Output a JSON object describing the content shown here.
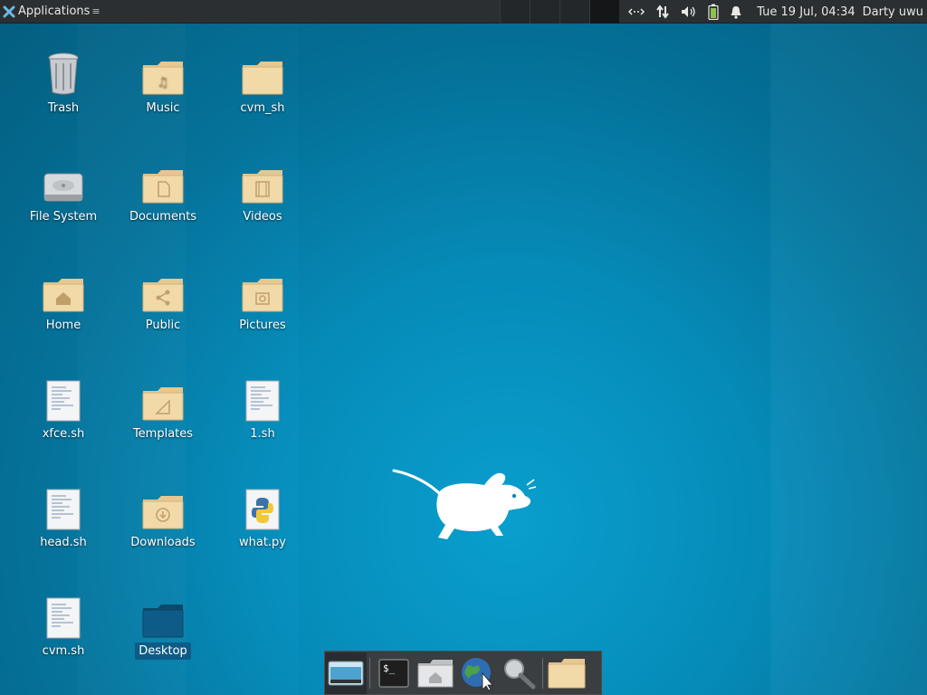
{
  "panel": {
    "applications_label": "Applications",
    "clock": "Tue 19 Jul, 04:34",
    "user": "Darty uwu",
    "tray_icons": [
      "network-transfer-icon",
      "network-icon",
      "volume-icon",
      "battery-icon",
      "notification-bell-icon"
    ]
  },
  "desktop": {
    "icons": [
      {
        "label": "Trash",
        "type": "trash"
      },
      {
        "label": "Music",
        "type": "folder-music"
      },
      {
        "label": "cvm_sh",
        "type": "folder"
      },
      {
        "label": "File System",
        "type": "drive"
      },
      {
        "label": "Documents",
        "type": "folder-documents"
      },
      {
        "label": "Videos",
        "type": "folder-videos"
      },
      {
        "label": "Home",
        "type": "folder-home"
      },
      {
        "label": "Public",
        "type": "folder-public"
      },
      {
        "label": "Pictures",
        "type": "folder-pictures"
      },
      {
        "label": "xfce.sh",
        "type": "text-file"
      },
      {
        "label": "Templates",
        "type": "folder-templates"
      },
      {
        "label": "1.sh",
        "type": "text-file"
      },
      {
        "label": "head.sh",
        "type": "text-file"
      },
      {
        "label": "Downloads",
        "type": "folder-downloads"
      },
      {
        "label": "what.py",
        "type": "python-file"
      },
      {
        "label": "cvm.sh",
        "type": "text-file"
      },
      {
        "label": "Desktop",
        "type": "folder-desktop",
        "selected": true
      }
    ]
  },
  "dock": {
    "items": [
      "show-desktop-icon",
      "terminal-icon",
      "home-folder-icon",
      "web-browser-icon",
      "search-icon",
      "file-manager-icon"
    ]
  },
  "colors": {
    "panel_bg": "#2b2f31",
    "desktop_bg": "#078dbb",
    "folder": "#f2d9a8",
    "selection": "#0d5b86"
  }
}
